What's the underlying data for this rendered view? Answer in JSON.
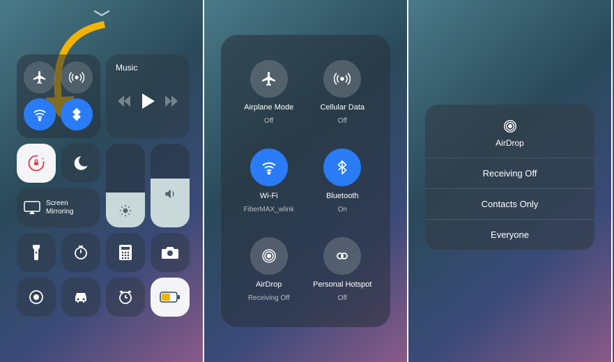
{
  "pane1": {
    "music_label": "Music",
    "mirror_label": "Screen\nMirroring"
  },
  "pane2": {
    "items": [
      {
        "name": "Airplane Mode",
        "status": "Off",
        "icon": "airplane",
        "on": false
      },
      {
        "name": "Cellular Data",
        "status": "Off",
        "icon": "antenna",
        "on": false
      },
      {
        "name": "Wi-Fi",
        "status": "FiberMAX_wlink",
        "icon": "wifi",
        "on": true
      },
      {
        "name": "Bluetooth",
        "status": "On",
        "icon": "bluetooth",
        "on": true
      },
      {
        "name": "AirDrop",
        "status": "Receiving Off",
        "icon": "airdrop",
        "on": false
      },
      {
        "name": "Personal Hotspot",
        "status": "Off",
        "icon": "hotspot",
        "on": false
      }
    ]
  },
  "pane3": {
    "title": "AirDrop",
    "options": [
      "Receiving Off",
      "Contacts Only",
      "Everyone"
    ]
  }
}
